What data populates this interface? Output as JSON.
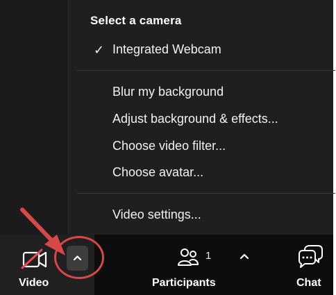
{
  "menu": {
    "title": "Select a camera",
    "check_glyph": "✓",
    "camera_option": "Integrated Webcam",
    "items": [
      "Blur my background",
      "Adjust background & effects...",
      "Choose video filter...",
      "Choose avatar..."
    ],
    "settings": "Video settings..."
  },
  "toolbar": {
    "video_label": "Video",
    "participants_label": "Participants",
    "participants_count": "1",
    "chat_label": "Chat"
  },
  "icons": {
    "video": "video-camera-off-icon",
    "chevron": "chevron-up-icon",
    "participants": "people-icon",
    "chat": "chat-bubbles-icon",
    "arrow": "red-arrow-annotation"
  },
  "colors": {
    "menu_bg": "#1f1f1f",
    "toolbar_bg": "#0d0d0d",
    "annotation_red": "#d94848"
  }
}
